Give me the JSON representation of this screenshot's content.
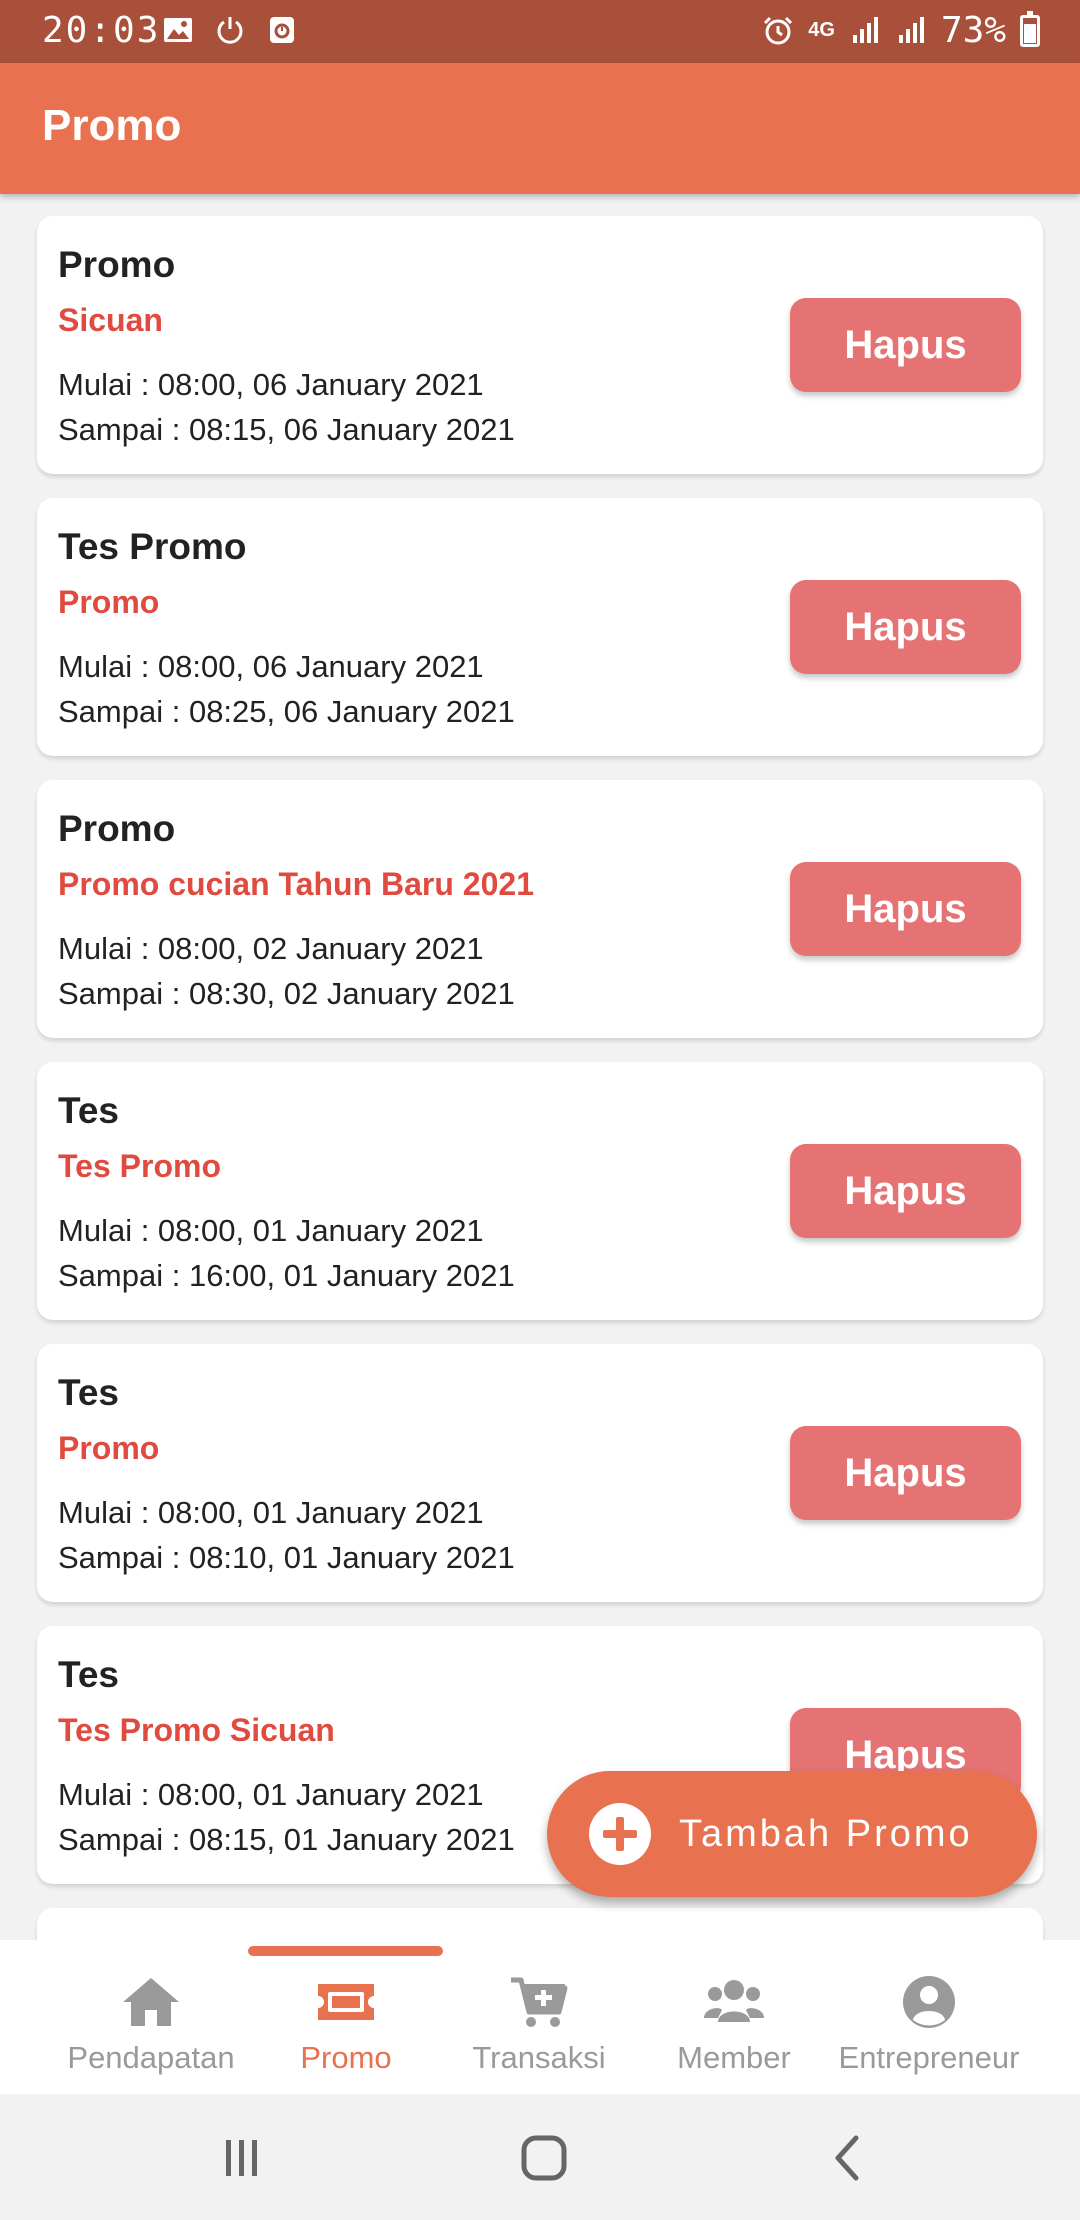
{
  "status_bar": {
    "time": "20:03",
    "network": "4G",
    "battery": "73%"
  },
  "app_bar": {
    "title": "Promo"
  },
  "promos": [
    {
      "title": "Promo",
      "subtitle": "Sicuan",
      "start": "Mulai : 08:00, 06 January 2021",
      "end": "Sampai : 08:15, 06 January 2021",
      "action": "Hapus"
    },
    {
      "title": "Tes Promo",
      "subtitle": "Promo",
      "start": "Mulai : 08:00, 06 January 2021",
      "end": "Sampai : 08:25, 06 January 2021",
      "action": "Hapus"
    },
    {
      "title": "Promo",
      "subtitle": "Promo cucian Tahun Baru 2021",
      "start": "Mulai : 08:00, 02 January 2021",
      "end": "Sampai : 08:30, 02 January 2021",
      "action": "Hapus"
    },
    {
      "title": "Tes",
      "subtitle": "Tes Promo",
      "start": "Mulai : 08:00, 01 January 2021",
      "end": "Sampai : 16:00, 01 January 2021",
      "action": "Hapus"
    },
    {
      "title": "Tes",
      "subtitle": "Promo",
      "start": "Mulai : 08:00, 01 January 2021",
      "end": "Sampai : 08:10, 01 January 2021",
      "action": "Hapus"
    },
    {
      "title": "Tes",
      "subtitle": "Tes Promo Sicuan",
      "start": "Mulai : 08:00, 01 January 2021",
      "end": "Sampai : 08:15, 01 January 2021",
      "action": "Hapus"
    }
  ],
  "fab": {
    "label": "Tambah Promo",
    "icon": "plus-circle-icon"
  },
  "bottom_nav": {
    "items": [
      {
        "label": "Pendapatan",
        "icon": "home-icon"
      },
      {
        "label": "Promo",
        "icon": "ticket-icon",
        "active": true
      },
      {
        "label": "Transaksi",
        "icon": "cart-plus-icon"
      },
      {
        "label": "Member",
        "icon": "users-icon"
      },
      {
        "label": "Entrepreneur",
        "icon": "user-circle-icon"
      }
    ]
  },
  "colors": {
    "primary": "#e8714f",
    "status_bar": "#a9503b",
    "accent_text": "#e04a3f",
    "delete_button": "#e57373",
    "inactive": "#9a9a9a"
  }
}
